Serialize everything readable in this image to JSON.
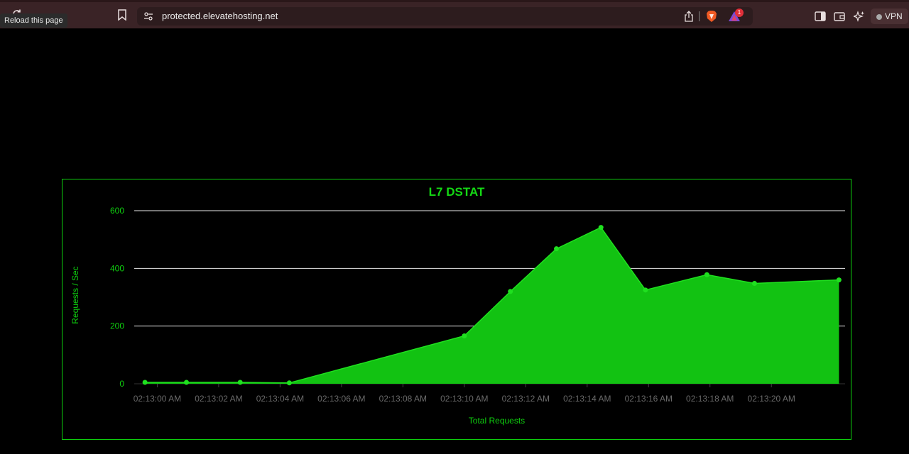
{
  "browser": {
    "tooltip": "Reload this page",
    "url": "protected.elevatehosting.net",
    "vpn_label": "VPN",
    "badge_count": "1"
  },
  "chart_data": {
    "type": "area",
    "title": "L7 DSTAT",
    "xlabel": "Total Requests",
    "ylabel": "Requests / Sec",
    "ylim": [
      0,
      600
    ],
    "yticks": [
      0,
      200,
      400,
      600
    ],
    "xticks": [
      "02:13:00 AM",
      "02:13:02 AM",
      "02:13:04 AM",
      "02:13:06 AM",
      "02:13:08 AM",
      "02:13:10 AM",
      "02:13:12 AM",
      "02:13:14 AM",
      "02:13:16 AM",
      "02:13:18 AM",
      "02:13:20 AM"
    ],
    "xlim_seconds": [
      -0.75,
      22.4
    ],
    "grid": true,
    "colors": {
      "fill": "#12c212",
      "line": "#1fe01f",
      "text": "#0fd00f",
      "tick": "#6a6a6a",
      "grid": "#e8e8e8"
    },
    "series": [
      {
        "t": [
          -0.4,
          0.95,
          2.7,
          4.3,
          10.0,
          11.5,
          13.0,
          14.45,
          15.9,
          17.9,
          19.45,
          22.2
        ],
        "values": [
          5,
          5,
          5,
          3,
          166,
          320,
          468,
          542,
          325,
          378,
          348,
          360
        ]
      }
    ]
  }
}
